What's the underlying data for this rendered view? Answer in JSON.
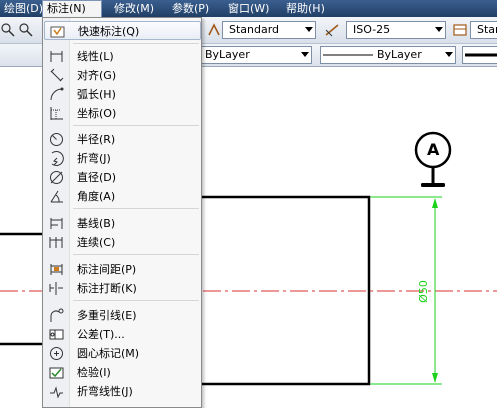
{
  "menubar": {
    "items": [
      {
        "label": "绘图(D)"
      },
      {
        "label": "标注(N)"
      },
      {
        "label": "修改(M)"
      },
      {
        "label": "参数(P)"
      },
      {
        "label": "窗口(W)"
      },
      {
        "label": "帮助(H)"
      }
    ]
  },
  "toolbar": {
    "text_style": "Standard",
    "dim_style": "ISO-25",
    "table_style_partial": "Star",
    "color_control": "ByLayer",
    "linetype_control": "ByLayer"
  },
  "dimension_menu": {
    "items": [
      {
        "label": "快速标注(Q)",
        "icon": "quick-dimension-icon"
      },
      {
        "label": "线性(L)",
        "icon": "linear-icon"
      },
      {
        "label": "对齐(G)",
        "icon": "aligned-icon"
      },
      {
        "label": "弧长(H)",
        "icon": "arc-length-icon"
      },
      {
        "label": "坐标(O)",
        "icon": "ordinate-icon"
      },
      {
        "label": "半径(R)",
        "icon": "radius-icon"
      },
      {
        "label": "折弯(J)",
        "icon": "jogged-icon"
      },
      {
        "label": "直径(D)",
        "icon": "diameter-icon"
      },
      {
        "label": "角度(A)",
        "icon": "angular-icon"
      },
      {
        "label": "基线(B)",
        "icon": "baseline-icon"
      },
      {
        "label": "连续(C)",
        "icon": "continue-icon"
      },
      {
        "label": "标注间距(P)",
        "icon": "dimension-space-icon"
      },
      {
        "label": "标注打断(K)",
        "icon": "dimension-break-icon"
      },
      {
        "label": "多重引线(E)",
        "icon": "multileader-icon"
      },
      {
        "label": "公差(T)...",
        "icon": "tolerance-icon"
      },
      {
        "label": "圆心标记(M)",
        "icon": "center-mark-icon"
      },
      {
        "label": "检验(I)",
        "icon": "inspection-icon"
      },
      {
        "label": "折弯线性(J)",
        "icon": "jogged-linear-icon"
      }
    ]
  },
  "drawing": {
    "datum_label": "A",
    "dimension_text": "Ø50",
    "dimension_color": "#1ad21a",
    "centerline_color": "#d83030"
  }
}
